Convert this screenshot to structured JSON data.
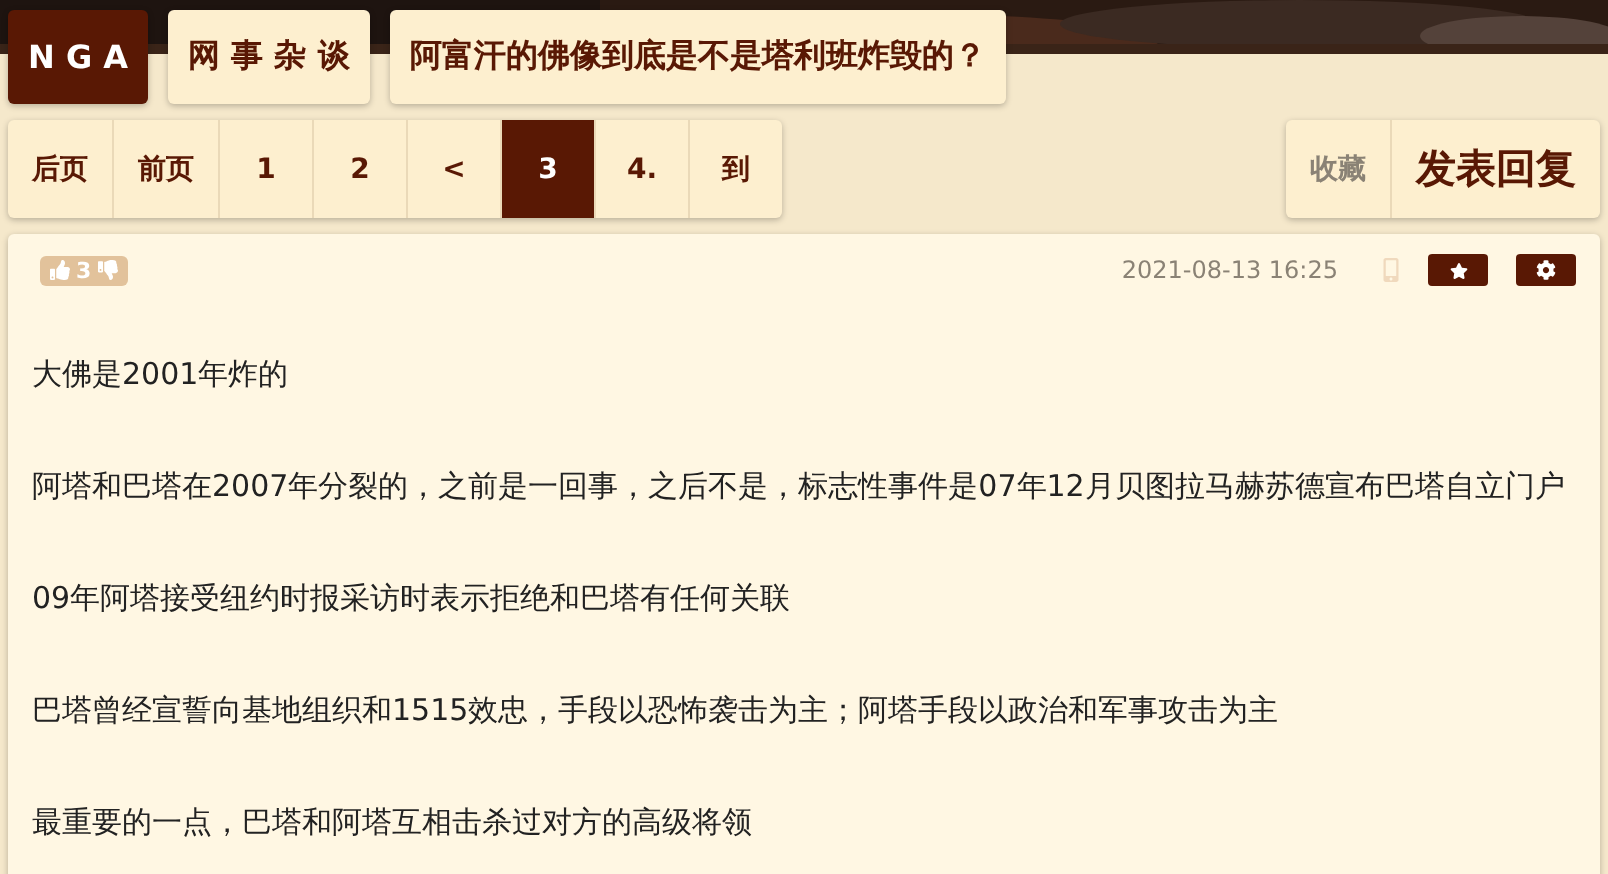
{
  "breadcrumb": [
    {
      "label": "N G A",
      "kind": "logo"
    },
    {
      "label": "网 事 杂 谈",
      "kind": "forum"
    },
    {
      "label": "阿富汗的佛像到底是不是塔利班炸毁的？",
      "kind": "topic"
    }
  ],
  "pagination": [
    {
      "label": "后页",
      "selected": false
    },
    {
      "label": "前页",
      "selected": false
    },
    {
      "label": "1",
      "selected": false
    },
    {
      "label": "2",
      "selected": false
    },
    {
      "label": "<",
      "selected": false
    },
    {
      "label": "3",
      "selected": true
    },
    {
      "label": "4.",
      "selected": false
    },
    {
      "label": "到",
      "selected": false
    }
  ],
  "actions": [
    {
      "label": "收藏",
      "kind": "secondary"
    },
    {
      "label": "发表回复",
      "kind": "primary"
    }
  ],
  "post": {
    "votes": "3",
    "date": "2021-08-13 16:25",
    "paragraphs": [
      "大佛是2001年炸的",
      "阿塔和巴塔在2007年分裂的，之前是一回事，之后不是，标志性事件是07年12月贝图拉马赫苏德宣布巴塔自立门户",
      "09年阿塔接受纽约时报采访时表示拒绝和巴塔有任何关联",
      "巴塔曾经宣誓向基地组织和1515效忠，手段以恐怖袭击为主；阿塔手段以政治和军事攻击为主",
      "最重要的一点，巴塔和阿塔互相击杀过对方的高级将领"
    ]
  }
}
